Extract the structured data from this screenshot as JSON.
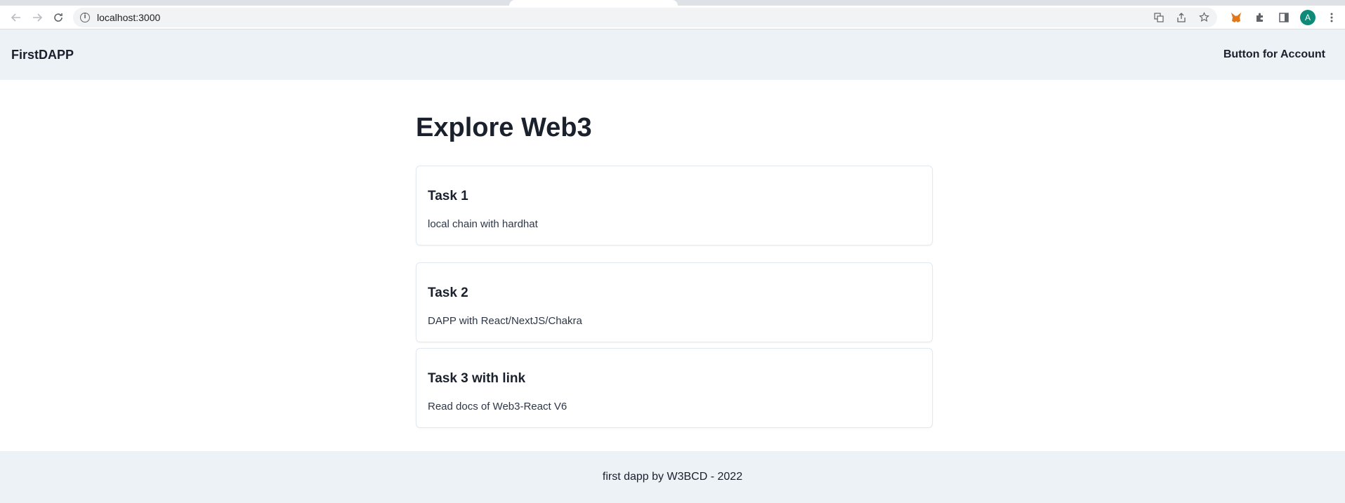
{
  "browser": {
    "url": "localhost:3000",
    "icons": {
      "back": "back-arrow-icon",
      "forward": "forward-arrow-icon",
      "reload": "reload-icon",
      "info": "info-icon",
      "translate": "translate-icon",
      "share": "share-icon",
      "bookmark": "star-icon",
      "metamask": "metamask-fox-icon",
      "extensions": "puzzle-icon",
      "side_panel": "side-panel-icon",
      "menu": "kebab-menu-icon"
    },
    "profile_initial": "A",
    "profile_color": "#0d8a78"
  },
  "header": {
    "brand": "FirstDAPP",
    "account_button": "Button for Account",
    "background": "#edf2f7"
  },
  "main": {
    "title": "Explore Web3",
    "cards": [
      {
        "title": "Task 1",
        "description": "local chain with hardhat"
      },
      {
        "title": "Task 2",
        "description": "DAPP with React/NextJS/Chakra"
      },
      {
        "title": "Task 3 with link",
        "description": "Read docs of Web3-React V6"
      }
    ]
  },
  "footer": {
    "text": "first dapp by W3BCD - 2022"
  }
}
